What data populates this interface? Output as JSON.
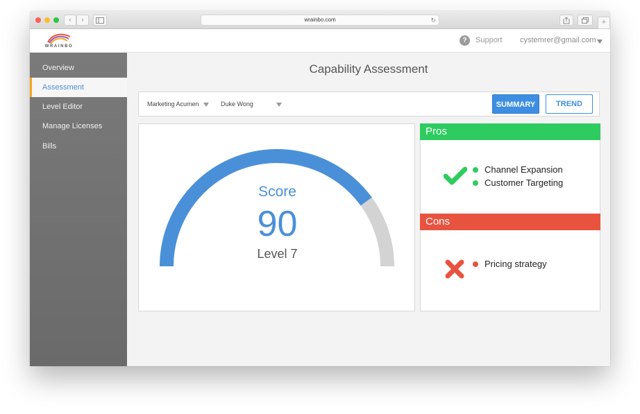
{
  "browser": {
    "url": "wrainbo.com",
    "nav_back_glyph": "‹",
    "nav_fwd_glyph": "›",
    "reload_glyph": "↻",
    "new_tab_glyph": "+"
  },
  "header": {
    "logo_text": "WRAINBO",
    "support_label": "Support",
    "help_glyph": "?",
    "account_email": "cystemrer@gmail.com"
  },
  "sidebar": {
    "items": [
      {
        "label": "Overview",
        "active": false
      },
      {
        "label": "Assessment",
        "active": true
      },
      {
        "label": "Level Editor",
        "active": false
      },
      {
        "label": "Manage Licenses",
        "active": false
      },
      {
        "label": "Bills",
        "active": false
      }
    ]
  },
  "main": {
    "title": "Capability Assessment",
    "filters": {
      "category": "Marketing Acumen",
      "person": "Duke Wong"
    },
    "buttons": {
      "summary": "SUMMARY",
      "trend": "TREND"
    },
    "score": {
      "label": "Score",
      "value": "90",
      "level": "Level 7",
      "gauge_fraction": 0.8
    },
    "pros": {
      "title": "Pros",
      "items": [
        "Channel Expansion",
        "Customer Targeting"
      ]
    },
    "cons": {
      "title": "Cons",
      "items": [
        "Pricing strategy"
      ]
    }
  },
  "colors": {
    "accent_blue": "#3d8ee3",
    "pros_green": "#2ecc60",
    "cons_red": "#e8533f",
    "gauge_track": "#d3d3d3"
  }
}
